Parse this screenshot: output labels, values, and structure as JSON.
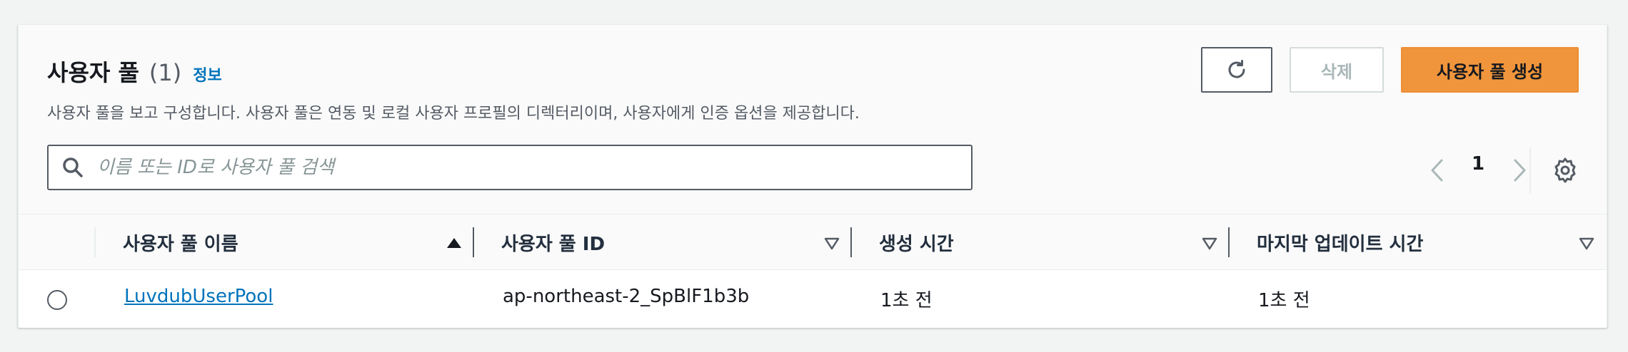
{
  "header": {
    "title": "사용자 풀",
    "count": "(1)",
    "info_link": "정보",
    "description": "사용자 풀을 보고 구성합니다. 사용자 풀은 연동 및 로컬 사용자 프로필의 디렉터리이며, 사용자에게 인증 옵션을 제공합니다."
  },
  "actions": {
    "refresh_icon": "refresh-icon",
    "delete_label": "삭제",
    "create_label": "사용자 풀 생성"
  },
  "search": {
    "placeholder": "이름 또는 ID로 사용자 풀 검색",
    "value": ""
  },
  "pagination": {
    "current_page": "1"
  },
  "table": {
    "columns": [
      {
        "label": "사용자 풀 이름",
        "sort": "ascending"
      },
      {
        "label": "사용자 풀 ID",
        "sort": "none"
      },
      {
        "label": "생성 시간",
        "sort": "none"
      },
      {
        "label": "마지막 업데이트 시간",
        "sort": "none"
      }
    ],
    "rows": [
      {
        "name": "LuvdubUserPool",
        "id": "ap-northeast-2_SpBlF1b3b",
        "created": "1초 전",
        "updated": "1초 전",
        "selected": false
      }
    ]
  },
  "colors": {
    "primary_button": "#f0953b",
    "link": "#0073bb",
    "text": "#16191f",
    "muted_text": "#545b64",
    "disabled_text": "#aab7b8"
  }
}
